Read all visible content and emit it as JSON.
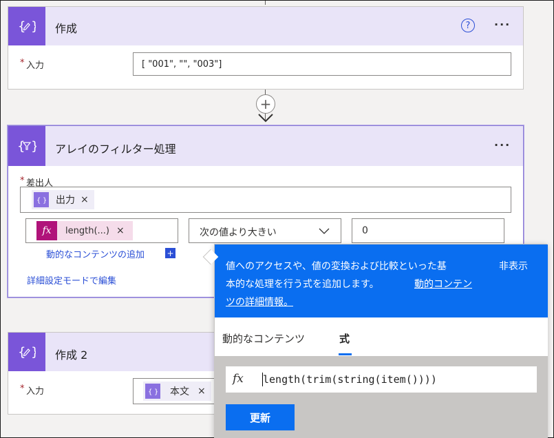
{
  "compose1": {
    "title": "作成",
    "required_mark": "*",
    "input_label": "入力",
    "input_value": "[ \"001\", \"\",  \"003\"]"
  },
  "filter": {
    "title": "アレイのフィルター処理",
    "required_mark": "*",
    "from_label": "差出人",
    "from_token": "出力",
    "cond_left_token": "length(...)",
    "operator": "次の値より大きい",
    "cond_right_value": "0",
    "add_dynamic_link": "動的なコンテンツの追加",
    "advanced_link": "詳細設定モードで編集"
  },
  "compose2": {
    "title": "作成 2",
    "required_mark": "*",
    "input_label": "入力",
    "input_token": "本文"
  },
  "popup": {
    "description_line1": "値へのアクセスや、値の変換および比較といった基",
    "description_line2": "本的な処理を行う式を追加します。",
    "learn_more_link_line1": "動的コンテン",
    "learn_more_link_line2": "ツの詳細情報。",
    "hide_label": "非表示",
    "tabs": [
      "動的なコンテンツ",
      "式"
    ],
    "expression": "length(trim(string(item())))",
    "update_button": "更新"
  },
  "icons": {
    "help": "?",
    "more": "···",
    "add": "+",
    "close": "×",
    "fx": "fx"
  },
  "colors": {
    "accent_purple": "#7a55d9",
    "header_lavender": "#e9e4f8",
    "blue": "#0a6ef0",
    "expression_token": "#b0137a"
  }
}
